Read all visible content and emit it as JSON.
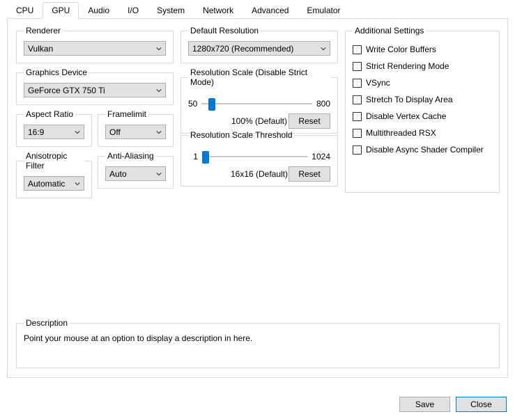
{
  "tabs": [
    "CPU",
    "GPU",
    "Audio",
    "I/O",
    "System",
    "Network",
    "Advanced",
    "Emulator"
  ],
  "active_tab": 1,
  "groups": {
    "renderer": {
      "title": "Renderer",
      "value": "Vulkan"
    },
    "graphics_device": {
      "title": "Graphics Device",
      "value": "GeForce GTX 750 Ti"
    },
    "aspect_ratio": {
      "title": "Aspect Ratio",
      "value": "16:9"
    },
    "framelimit": {
      "title": "Framelimit",
      "value": "Off"
    },
    "aniso": {
      "title": "Anisotropic Filter",
      "value": "Automatic"
    },
    "aa": {
      "title": "Anti-Aliasing",
      "value": "Auto"
    },
    "default_res": {
      "title": "Default Resolution",
      "value": "1280x720 (Recommended)"
    },
    "res_scale": {
      "title": "Resolution Scale (Disable Strict Mode)",
      "min": "50",
      "max": "800",
      "status": "100% (Default)",
      "reset": "Reset"
    },
    "res_thresh": {
      "title": "Resolution Scale Threshold",
      "min": "1",
      "max": "1024",
      "status": "16x16 (Default)",
      "reset": "Reset"
    },
    "additional": {
      "title": "Additional Settings",
      "items": [
        "Write Color Buffers",
        "Strict Rendering Mode",
        "VSync",
        "Stretch To Display Area",
        "Disable Vertex Cache",
        "Multithreaded RSX",
        "Disable Async Shader Compiler"
      ]
    },
    "description": {
      "title": "Description",
      "text": "Point your mouse at an option to display a description in here."
    }
  },
  "buttons": {
    "save": "Save",
    "close": "Close"
  }
}
